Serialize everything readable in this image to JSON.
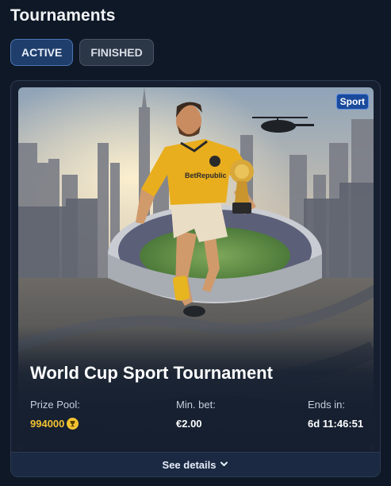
{
  "page": {
    "title": "Tournaments"
  },
  "tabs": [
    {
      "label": "ACTIVE",
      "active": true
    },
    {
      "label": "FINISHED",
      "active": false
    }
  ],
  "tournament": {
    "badge": "Sport",
    "name": "World Cup Sport Tournament",
    "image_description_icon": "football-player-stadium-image",
    "prize_label": "Prize Pool:",
    "prize_value": "994000",
    "prize_icon": "trophy-coin-icon",
    "minbet_label": "Min. bet:",
    "minbet_value": "€2.00",
    "ends_label": "Ends in:",
    "ends_value": "6d 11:46:51",
    "details_label": "See details",
    "details_icon": "chevron-down-icon"
  },
  "colors": {
    "background": "#0f1826",
    "card": "#151f30",
    "accent": "#1f3e6b",
    "prize": "#f2c230",
    "badge": "#1a4a9c"
  }
}
